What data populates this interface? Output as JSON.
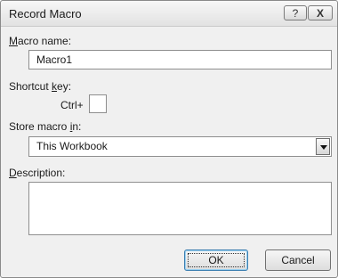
{
  "dialog": {
    "title": "Record Macro",
    "help_button": "?",
    "close_button": "X"
  },
  "macro_name": {
    "label_pre": "",
    "label_ul": "M",
    "label_post": "acro name:",
    "value": "Macro1"
  },
  "shortcut": {
    "label_pre": "Shortcut ",
    "label_ul": "k",
    "label_post": "ey:",
    "prefix": "Ctrl+",
    "value": ""
  },
  "store": {
    "label_pre": "Store macro ",
    "label_ul": "i",
    "label_post": "n:",
    "selected": "This Workbook"
  },
  "description": {
    "label_pre": "",
    "label_ul": "D",
    "label_post": "escription:",
    "value": ""
  },
  "buttons": {
    "ok": "OK",
    "cancel": "Cancel"
  }
}
